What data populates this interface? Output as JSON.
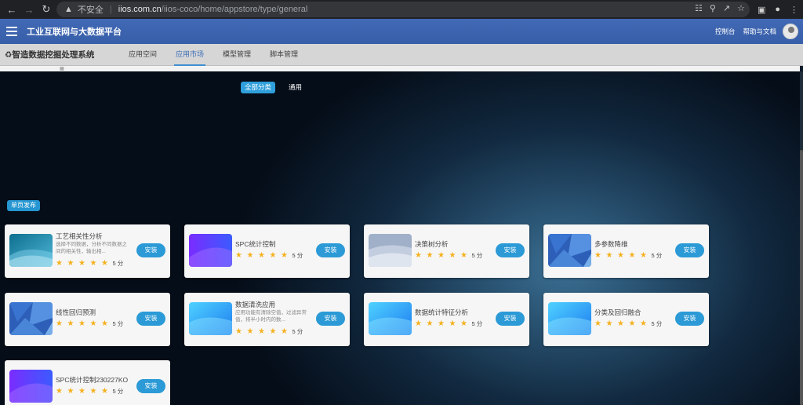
{
  "browser": {
    "security_label": "不安全",
    "url_host": "iios.com.cn",
    "url_path": "/iios-coco/home/appstore/type/general"
  },
  "header": {
    "app_title": "工业互联网与大数据平台",
    "links": [
      "控制台",
      "帮助与文档"
    ]
  },
  "subnav": {
    "system_title": "智造数据挖掘处理系统",
    "tabs": [
      {
        "label": "应用空间",
        "active": false
      },
      {
        "label": "应用市场",
        "active": true
      },
      {
        "label": "模型管理",
        "active": false
      },
      {
        "label": "脚本管理",
        "active": false
      }
    ]
  },
  "filters": [
    {
      "label": "全部分类",
      "active": true
    },
    {
      "label": "通用",
      "active": false
    }
  ],
  "publish_button": "单页发布",
  "colors": {
    "header_blue": "#3f63b0",
    "install_blue": "#2b9ad6",
    "star_gold": "#f5b11f"
  },
  "cards": [
    {
      "title": "工艺相关性分析",
      "desc": "选择不同数据，分析不同数据之间的相关性，输出相...",
      "score": "5 分",
      "stars": 5,
      "install": "安装",
      "thumb": "teal-wave"
    },
    {
      "title": "SPC统计控制",
      "desc": "",
      "score": "5 分",
      "stars": 5,
      "install": "安装",
      "thumb": "purple-wave"
    },
    {
      "title": "决策树分析",
      "desc": "",
      "score": "5 分",
      "stars": 5,
      "install": "安装",
      "thumb": "grey-wave"
    },
    {
      "title": "多参数降维",
      "desc": "",
      "score": "5 分",
      "stars": 5,
      "install": "安装",
      "thumb": "blue-poly"
    },
    {
      "title": "线性回归预测",
      "desc": "",
      "score": "5 分",
      "stars": 5,
      "install": "安装",
      "thumb": "blue-poly"
    },
    {
      "title": "数据清洗应用",
      "desc": "应用功能有清除空值，过滤异常值，将半小时内的数...",
      "score": "5 分",
      "stars": 5,
      "install": "安装",
      "thumb": "cyan-wave"
    },
    {
      "title": "数据统计特征分析",
      "desc": "",
      "score": "5 分",
      "stars": 5,
      "install": "安装",
      "thumb": "cyan-wave"
    },
    {
      "title": "分类及回归融合",
      "desc": "",
      "score": "5 分",
      "stars": 5,
      "install": "安装",
      "thumb": "cyan-wave"
    },
    {
      "title": "SPC统计控制230227KO",
      "desc": "",
      "score": "5 分",
      "stars": 5,
      "install": "安装",
      "thumb": "purple-wave"
    }
  ]
}
